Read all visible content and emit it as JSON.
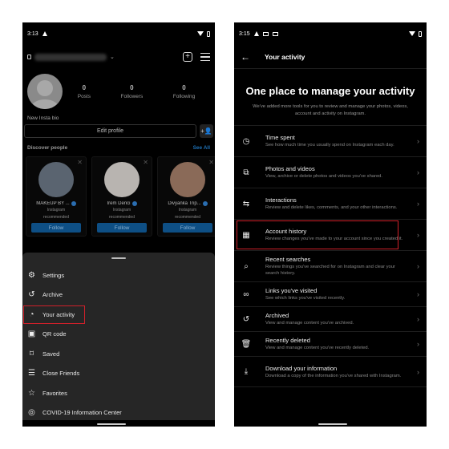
{
  "left": {
    "status": {
      "time": "3:13"
    },
    "profile": {
      "stats": [
        {
          "value": "0",
          "label": "Posts"
        },
        {
          "value": "0",
          "label": "Followers"
        },
        {
          "value": "0",
          "label": "Following"
        }
      ],
      "bio": "New Insta bio",
      "edit_profile": "Edit profile"
    },
    "discover": {
      "title": "Discover people",
      "see_all": "See All",
      "cards": [
        {
          "name": "MAKEUP BY ...",
          "subtitle_1": "Instagram",
          "subtitle_2": "recommended",
          "follow": "Follow",
          "photo_color": "#5a6470"
        },
        {
          "name": "İrem Derici",
          "subtitle_1": "Instagram",
          "subtitle_2": "recommended",
          "follow": "Follow",
          "photo_color": "#b8b4b0"
        },
        {
          "name": "Divyanka Trip...",
          "subtitle_1": "Instagram",
          "subtitle_2": "recommended",
          "follow": "Follow",
          "photo_color": "#8a6a58"
        }
      ]
    },
    "menu": [
      {
        "label": "Settings",
        "icon": "settings-icon"
      },
      {
        "label": "Archive",
        "icon": "archive-icon"
      },
      {
        "label": "Your activity",
        "icon": "activity-icon",
        "highlighted": true
      },
      {
        "label": "QR code",
        "icon": "qr-code-icon"
      },
      {
        "label": "Saved",
        "icon": "bookmark-icon"
      },
      {
        "label": "Close Friends",
        "icon": "list-icon"
      },
      {
        "label": "Favorites",
        "icon": "star-icon"
      },
      {
        "label": "COVID-19 Information Center",
        "icon": "covid-info-icon"
      }
    ]
  },
  "right": {
    "status": {
      "time": "3:15"
    },
    "header": {
      "title": "Your activity"
    },
    "hero": {
      "title": "One place to manage your activity",
      "subtitle": "We've added more tools for you to review and manage your photos, videos, account and activity on Instagram."
    },
    "items": [
      {
        "title": "Time spent",
        "desc": "See how much time you usually spend on Instagram each day.",
        "icon": "clock-icon"
      },
      {
        "title": "Photos and videos",
        "desc": "View, archive or delete photos and videos you've shared.",
        "icon": "media-icon"
      },
      {
        "title": "Interactions",
        "desc": "Review and delete likes, comments, and your other interactions.",
        "icon": "interactions-icon"
      },
      {
        "title": "Account history",
        "desc": "Review changes you've made to your account since you created it.",
        "icon": "calendar-icon",
        "highlighted": true
      },
      {
        "title": "Recent searches",
        "desc": "Review things you've searched for on Instagram and clear your search history.",
        "icon": "search-icon"
      },
      {
        "title": "Links you've visited",
        "desc": "See which links you've visited recently.",
        "icon": "link-icon"
      },
      {
        "title": "Archived",
        "desc": "View and manage content you've archived.",
        "icon": "archive-icon"
      },
      {
        "title": "Recently deleted",
        "desc": "View and manage content you've recently deleted.",
        "icon": "trash-icon"
      },
      {
        "title": "Download your information",
        "desc": "Download a copy of the information you've shared with Instagram.",
        "icon": "download-icon"
      }
    ]
  },
  "colors": {
    "highlight": "#d0202a",
    "link": "#1e6fb3",
    "follow_bg": "#0e4f85"
  }
}
